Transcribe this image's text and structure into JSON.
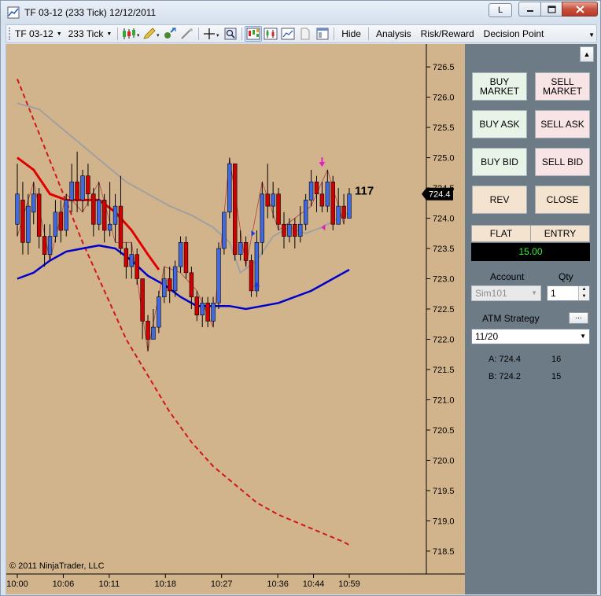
{
  "window": {
    "title": "TF 03-12 (233 Tick)  12/12/2011",
    "link_button": "L"
  },
  "toolbar": {
    "instrument": "TF 03-12",
    "interval": "233 Tick",
    "hide": "Hide",
    "analysis": "Analysis",
    "risk_reward": "Risk/Reward",
    "decision_point": "Decision Point"
  },
  "chart": {
    "copyright": "© 2011 NinjaTrader, LLC",
    "last_price": "724.4",
    "counter": "117",
    "colors": {
      "background": "#d2b48c",
      "up_candle": "#4169e1",
      "down_candle": "#d00000",
      "ma_fast": "#e00000",
      "ma_slow": "#0000cc",
      "band": "#d01818",
      "ma_gray": "#a0a0a0"
    }
  },
  "chart_data": {
    "type": "candlestick",
    "x_ticks": [
      "10:00",
      "10:06",
      "10:11",
      "10:18",
      "10:27",
      "10:36",
      "10:44",
      "10:59"
    ],
    "y_ticks": [
      "726.5",
      "726.0",
      "725.5",
      "725.0",
      "724.5",
      "724.0",
      "723.5",
      "723.0",
      "722.5",
      "722.0",
      "721.5",
      "721.0",
      "720.5",
      "720.0",
      "719.5",
      "719.0",
      "718.5"
    ],
    "ylim": [
      718.2,
      726.8
    ],
    "grid": false,
    "candles": [
      {
        "o": 723.9,
        "c": 724.4,
        "h": 724.9,
        "l": 723.7
      },
      {
        "o": 724.3,
        "c": 723.6,
        "h": 724.6,
        "l": 723.4
      },
      {
        "o": 723.6,
        "c": 724.2,
        "h": 724.4,
        "l": 723.4
      },
      {
        "o": 724.1,
        "c": 724.4,
        "h": 724.6,
        "l": 723.9
      },
      {
        "o": 724.4,
        "c": 723.7,
        "h": 724.5,
        "l": 723.5
      },
      {
        "o": 723.7,
        "c": 723.4,
        "h": 723.9,
        "l": 723.2
      },
      {
        "o": 723.4,
        "c": 723.7,
        "h": 723.9,
        "l": 723.3
      },
      {
        "o": 723.7,
        "c": 724.1,
        "h": 724.3,
        "l": 723.6
      },
      {
        "o": 724.1,
        "c": 723.8,
        "h": 724.3,
        "l": 723.6
      },
      {
        "o": 723.8,
        "c": 724.3,
        "h": 724.4,
        "l": 723.7
      },
      {
        "o": 724.3,
        "c": 724.6,
        "h": 724.9,
        "l": 724.1
      },
      {
        "o": 724.6,
        "c": 724.3,
        "h": 725.1,
        "l": 724.1
      },
      {
        "o": 724.3,
        "c": 724.7,
        "h": 724.8,
        "l": 724.1
      },
      {
        "o": 724.7,
        "c": 724.4,
        "h": 724.9,
        "l": 724.2
      },
      {
        "o": 724.4,
        "c": 723.9,
        "h": 724.5,
        "l": 723.7
      },
      {
        "o": 723.9,
        "c": 724.3,
        "h": 724.6,
        "l": 723.8
      },
      {
        "o": 724.3,
        "c": 723.8,
        "h": 724.4,
        "l": 723.6
      },
      {
        "o": 723.8,
        "c": 723.9,
        "h": 724.6,
        "l": 723.7
      },
      {
        "o": 723.9,
        "c": 724.2,
        "h": 724.4,
        "l": 723.6
      },
      {
        "o": 724.2,
        "c": 723.5,
        "h": 724.7,
        "l": 723.4
      },
      {
        "o": 723.5,
        "c": 723.2,
        "h": 723.6,
        "l": 723.0
      },
      {
        "o": 723.2,
        "c": 723.4,
        "h": 723.6,
        "l": 723.0
      },
      {
        "o": 723.4,
        "c": 723.0,
        "h": 723.5,
        "l": 722.9
      },
      {
        "o": 723.0,
        "c": 722.3,
        "h": 723.0,
        "l": 722.0
      },
      {
        "o": 722.3,
        "c": 722.0,
        "h": 722.4,
        "l": 721.8
      },
      {
        "o": 722.0,
        "c": 722.2,
        "h": 722.5,
        "l": 722.0
      },
      {
        "o": 722.2,
        "c": 722.7,
        "h": 722.8,
        "l": 722.1
      },
      {
        "o": 722.7,
        "c": 723.0,
        "h": 723.2,
        "l": 722.6
      },
      {
        "o": 723.0,
        "c": 722.8,
        "h": 723.2,
        "l": 722.6
      },
      {
        "o": 722.8,
        "c": 723.2,
        "h": 723.3,
        "l": 722.7
      },
      {
        "o": 723.2,
        "c": 723.6,
        "h": 723.7,
        "l": 723.1
      },
      {
        "o": 723.6,
        "c": 723.1,
        "h": 723.7,
        "l": 723.0
      },
      {
        "o": 723.1,
        "c": 722.7,
        "h": 723.2,
        "l": 722.5
      },
      {
        "o": 722.7,
        "c": 722.4,
        "h": 722.8,
        "l": 722.3
      },
      {
        "o": 722.4,
        "c": 722.6,
        "h": 722.7,
        "l": 722.2
      },
      {
        "o": 722.6,
        "c": 722.3,
        "h": 722.7,
        "l": 722.2
      },
      {
        "o": 722.3,
        "c": 722.6,
        "h": 722.7,
        "l": 722.2
      },
      {
        "o": 722.6,
        "c": 723.5,
        "h": 723.6,
        "l": 722.5
      },
      {
        "o": 723.5,
        "c": 724.1,
        "h": 724.1,
        "l": 723.4
      },
      {
        "o": 724.1,
        "c": 724.9,
        "h": 725.0,
        "l": 724.0
      },
      {
        "o": 724.9,
        "c": 723.4,
        "h": 724.9,
        "l": 723.3
      },
      {
        "o": 723.4,
        "c": 723.6,
        "h": 723.8,
        "l": 723.3
      },
      {
        "o": 723.6,
        "c": 723.3,
        "h": 723.7,
        "l": 723.2
      },
      {
        "o": 723.3,
        "c": 722.8,
        "h": 723.4,
        "l": 722.7
      },
      {
        "o": 722.8,
        "c": 723.6,
        "h": 723.8,
        "l": 722.7
      },
      {
        "o": 723.6,
        "c": 724.4,
        "h": 724.6,
        "l": 723.4
      },
      {
        "o": 724.4,
        "c": 724.2,
        "h": 724.9,
        "l": 724.0
      },
      {
        "o": 724.2,
        "c": 724.4,
        "h": 724.6,
        "l": 724.0
      },
      {
        "o": 724.4,
        "c": 723.9,
        "h": 724.5,
        "l": 723.8
      },
      {
        "o": 723.9,
        "c": 723.7,
        "h": 724.1,
        "l": 723.5
      },
      {
        "o": 723.7,
        "c": 723.9,
        "h": 724.0,
        "l": 723.6
      },
      {
        "o": 723.9,
        "c": 723.7,
        "h": 724.0,
        "l": 723.5
      },
      {
        "o": 723.7,
        "c": 723.9,
        "h": 724.2,
        "l": 723.6
      },
      {
        "o": 723.9,
        "c": 724.3,
        "h": 724.4,
        "l": 723.8
      },
      {
        "o": 724.3,
        "c": 724.6,
        "h": 724.8,
        "l": 724.2
      },
      {
        "o": 724.6,
        "c": 724.4,
        "h": 724.7,
        "l": 724.1
      },
      {
        "o": 724.4,
        "c": 724.2,
        "h": 724.6,
        "l": 724.1
      },
      {
        "o": 724.2,
        "c": 724.6,
        "h": 724.8,
        "l": 724.1
      },
      {
        "o": 724.6,
        "c": 723.9,
        "h": 724.7,
        "l": 723.8
      },
      {
        "o": 723.9,
        "c": 724.2,
        "h": 724.5,
        "l": 723.9
      },
      {
        "o": 724.2,
        "c": 724.0,
        "h": 724.4,
        "l": 723.9
      },
      {
        "o": 724.0,
        "c": 724.4,
        "h": 724.5,
        "l": 724.0
      }
    ],
    "ma_fast": [
      [
        0,
        725.0
      ],
      [
        3,
        724.8
      ],
      [
        6,
        724.4
      ],
      [
        9,
        724.3
      ],
      [
        12,
        724.3
      ],
      [
        15,
        724.3
      ],
      [
        18,
        724.1
      ],
      [
        21,
        723.8
      ],
      [
        24,
        723.4
      ],
      [
        26,
        723.15
      ]
    ],
    "ma_gray": [
      [
        0,
        725.9
      ],
      [
        4,
        725.8
      ],
      [
        8,
        725.5
      ],
      [
        12,
        725.2
      ],
      [
        16,
        724.9
      ],
      [
        20,
        724.6
      ],
      [
        24,
        724.4
      ],
      [
        28,
        724.2
      ],
      [
        32,
        724.05
      ],
      [
        36,
        723.85
      ],
      [
        39,
        723.6
      ],
      [
        41,
        723.1
      ],
      [
        44,
        723.3
      ],
      [
        47,
        723.7
      ],
      [
        50,
        723.85
      ],
      [
        53,
        723.75
      ],
      [
        56,
        723.85
      ],
      [
        59,
        724.0
      ],
      [
        61,
        724.1
      ]
    ],
    "ma_slow": [
      [
        0,
        723.0
      ],
      [
        3,
        723.1
      ],
      [
        6,
        723.3
      ],
      [
        9,
        723.45
      ],
      [
        12,
        723.5
      ],
      [
        15,
        723.55
      ],
      [
        18,
        723.5
      ],
      [
        21,
        723.3
      ],
      [
        24,
        723.05
      ],
      [
        27,
        722.9
      ],
      [
        30,
        722.7
      ],
      [
        33,
        722.55
      ],
      [
        36,
        722.55
      ],
      [
        39,
        722.55
      ],
      [
        42,
        722.5
      ],
      [
        45,
        722.55
      ],
      [
        48,
        722.6
      ],
      [
        51,
        722.7
      ],
      [
        54,
        722.8
      ],
      [
        57,
        722.95
      ],
      [
        60,
        723.1
      ],
      [
        61,
        723.15
      ]
    ],
    "band_lower": [
      [
        0,
        726.3
      ],
      [
        4,
        725.4
      ],
      [
        8,
        724.5
      ],
      [
        12,
        723.6
      ],
      [
        16,
        722.8
      ],
      [
        20,
        722.0
      ],
      [
        24,
        721.4
      ],
      [
        28,
        720.8
      ],
      [
        32,
        720.3
      ],
      [
        36,
        719.9
      ],
      [
        40,
        719.6
      ],
      [
        44,
        719.3
      ],
      [
        48,
        719.1
      ],
      [
        52,
        718.95
      ],
      [
        56,
        718.8
      ],
      [
        60,
        718.65
      ],
      [
        61,
        718.6
      ]
    ]
  },
  "panel": {
    "buy_market": "BUY\nMARKET",
    "sell_market": "SELL\nMARKET",
    "buy_ask": "BUY ASK",
    "sell_ask": "SELL ASK",
    "buy_bid": "BUY BID",
    "sell_bid": "SELL BID",
    "rev": "REV",
    "close": "CLOSE",
    "position": "FLAT",
    "entry": "ENTRY",
    "pnl": "15.00",
    "account_label": "Account",
    "qty_label": "Qty",
    "account_value": "Sim101",
    "qty_value": "1",
    "atm_label": "ATM Strategy",
    "atm_more": "...",
    "atm_value": "11/20",
    "ask_label": "A: 724.4",
    "ask_size": "16",
    "bid_label": "B: 724.2",
    "bid_size": "15"
  }
}
